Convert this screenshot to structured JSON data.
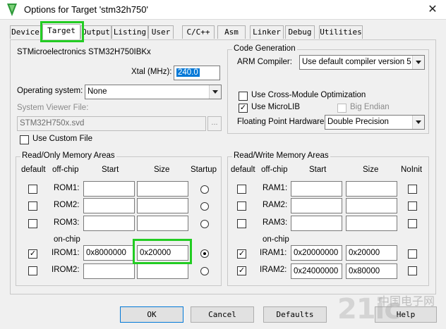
{
  "window": {
    "title": "Options for Target 'stm32h750'",
    "close_glyph": "✕"
  },
  "tabs": [
    "Device",
    "Target",
    "Output",
    "Listing",
    "User",
    "C/C++",
    "Asm",
    "Linker",
    "Debug",
    "Utilities"
  ],
  "active_tab": "Target",
  "target": {
    "device_name": "STMicroelectronics STM32H750IBKx",
    "xtal_label": "Xtal (MHz):",
    "xtal_value": "240.0",
    "os_label": "Operating system:",
    "os_value": "None",
    "svd_label": "System Viewer File:",
    "svd_value": "STM32H750x.svd",
    "browse_label": "...",
    "custom_file_label": "Use Custom File"
  },
  "codegen": {
    "title": "Code Generation",
    "compiler_label": "ARM Compiler:",
    "compiler_value": "Use default compiler version 5",
    "cross_module_label": "Use Cross-Module Optimization",
    "microlib_label": "Use MicroLIB",
    "microlib_checked": true,
    "big_endian_label": "Big Endian",
    "fp_label": "Floating Point Hardware:",
    "fp_value": "Double Precision"
  },
  "rom": {
    "title": "Read/Only Memory Areas",
    "headers": {
      "default": "default",
      "offchip": "off-chip",
      "start": "Start",
      "size": "Size",
      "startup": "Startup"
    },
    "onchip_label": "on-chip",
    "rows": [
      {
        "name": "ROM1:",
        "start": "",
        "size": "",
        "default": false,
        "startup": false
      },
      {
        "name": "ROM2:",
        "start": "",
        "size": "",
        "default": false,
        "startup": false
      },
      {
        "name": "ROM3:",
        "start": "",
        "size": "",
        "default": false,
        "startup": false
      },
      {
        "name": "IROM1:",
        "start": "0x8000000",
        "size": "0x20000",
        "default": true,
        "startup": true
      },
      {
        "name": "IROM2:",
        "start": "",
        "size": "",
        "default": false,
        "startup": false
      }
    ]
  },
  "ram": {
    "title": "Read/Write Memory Areas",
    "headers": {
      "default": "default",
      "offchip": "off-chip",
      "start": "Start",
      "size": "Size",
      "noinit": "NoInit"
    },
    "onchip_label": "on-chip",
    "rows": [
      {
        "name": "RAM1:",
        "start": "",
        "size": "",
        "default": false,
        "noinit": false
      },
      {
        "name": "RAM2:",
        "start": "",
        "size": "",
        "default": false,
        "noinit": false
      },
      {
        "name": "RAM3:",
        "start": "",
        "size": "",
        "default": false,
        "noinit": false
      },
      {
        "name": "IRAM1:",
        "start": "0x20000000",
        "size": "0x20000",
        "default": true,
        "noinit": false
      },
      {
        "name": "IRAM2:",
        "start": "0x24000000",
        "size": "0x80000",
        "default": true,
        "noinit": false
      }
    ]
  },
  "buttons": {
    "ok": "OK",
    "cancel": "Cancel",
    "defaults": "Defaults",
    "help": "Help"
  },
  "watermark": {
    "big": "21ic",
    "small": "中国电子网"
  },
  "colors": {
    "highlight": "#22cc22",
    "selection": "#0078d7"
  }
}
